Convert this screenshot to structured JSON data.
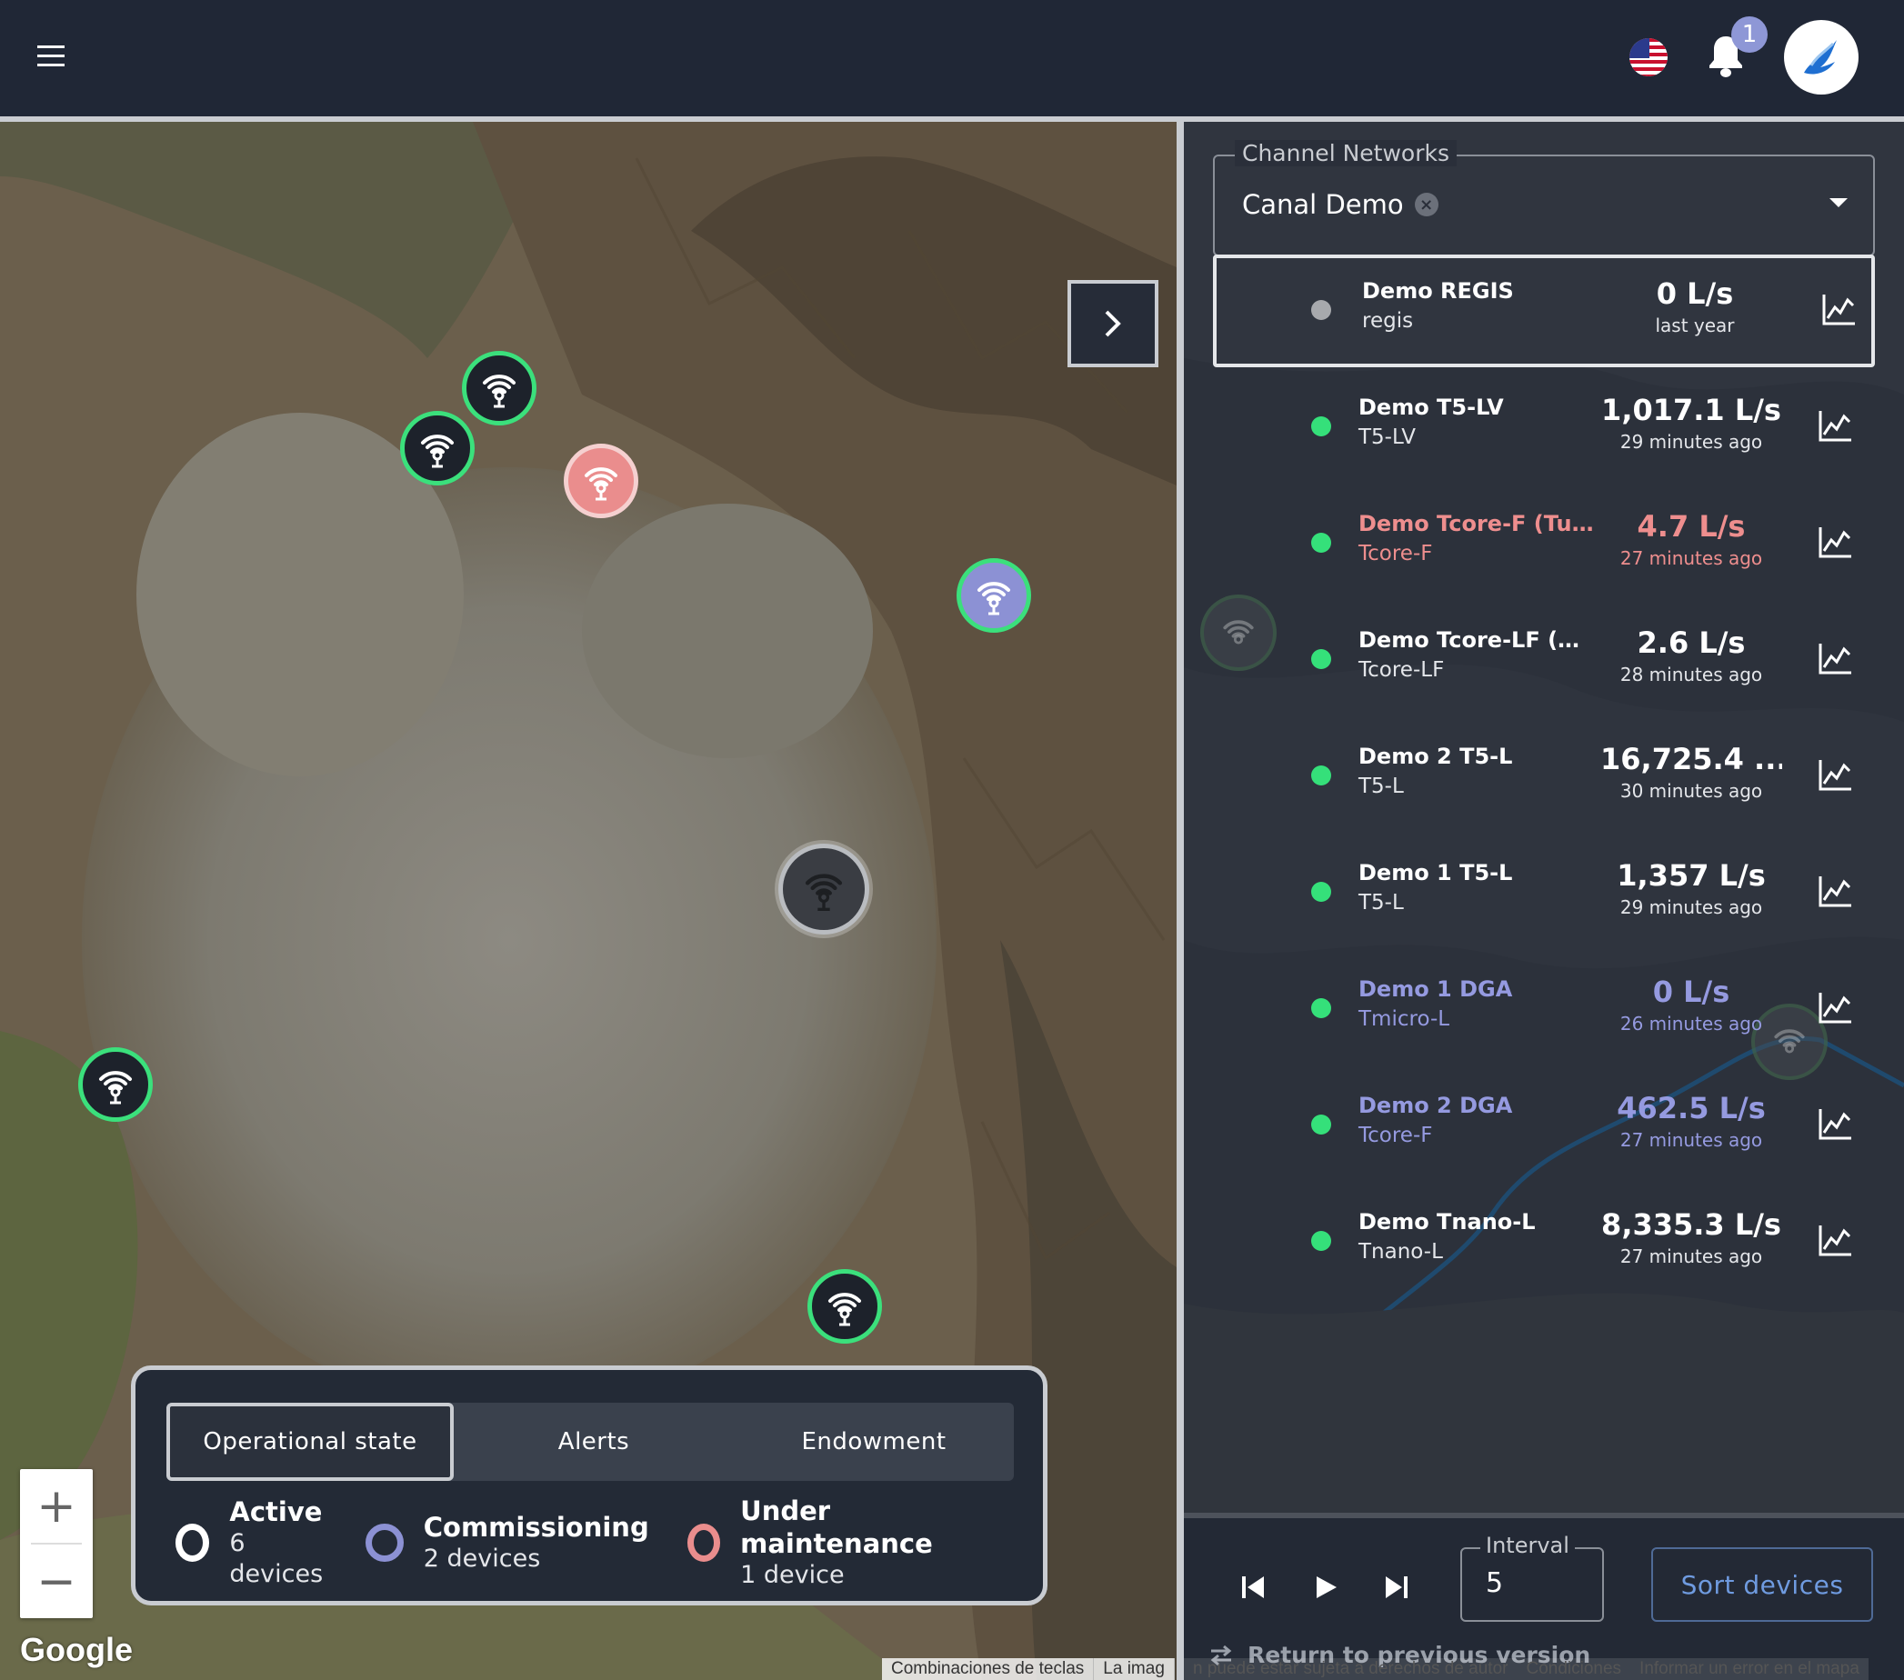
{
  "header": {
    "menu_icon": "hamburger-menu-icon",
    "language_flag": "us-flag-icon",
    "notifications_count": "1",
    "avatar_icon": "bird-logo-icon"
  },
  "map": {
    "google_logo": "Google",
    "attribution": [
      "Combinaciones de teclas",
      "La imag"
    ],
    "zoom_in": "+",
    "zoom_out": "−"
  },
  "legend": {
    "tabs": [
      "Operational state",
      "Alerts",
      "Endowment"
    ],
    "selected_tab": "Operational state",
    "items": [
      {
        "title": "Active",
        "sub": "6 devices",
        "color": "#ffffff"
      },
      {
        "title": "Commissioning",
        "sub": "2 devices",
        "color": "#8c91d4"
      },
      {
        "title": "Under maintenance",
        "sub": "1 device",
        "color": "#ea8d8d"
      }
    ]
  },
  "panel": {
    "channel_label": "Channel Networks",
    "channel_value": "Canal Demo",
    "devices": [
      {
        "name": "Demo REGIS",
        "code": "regis",
        "value": "0 L/s",
        "time": "last year",
        "status": "inactive"
      },
      {
        "name": "Demo T5-LV",
        "code": "T5-LV",
        "value": "1,017.1 L/s",
        "time": "29 minutes ago",
        "status": "active"
      },
      {
        "name": "Demo Tcore-F (Tub...",
        "code": "Tcore-F",
        "value": "4.7 L/s",
        "time": "27 minutes ago",
        "status": "maintenance"
      },
      {
        "name": "Demo Tcore-LF (Po...",
        "code": "Tcore-LF",
        "value": "2.6 L/s",
        "time": "28 minutes ago",
        "status": "active"
      },
      {
        "name": "Demo 2 T5-L",
        "code": "T5-L",
        "value": "16,725.4 ...",
        "time": "30 minutes ago",
        "status": "active"
      },
      {
        "name": "Demo 1 T5-L",
        "code": "T5-L",
        "value": "1,357 L/s",
        "time": "29 minutes ago",
        "status": "active"
      },
      {
        "name": "Demo 1 DGA",
        "code": "Tmicro-L",
        "value": "0 L/s",
        "time": "26 minutes ago",
        "status": "commissioning"
      },
      {
        "name": "Demo 2 DGA",
        "code": "Tcore-F",
        "value": "462.5 L/s",
        "time": "27 minutes ago",
        "status": "commissioning"
      },
      {
        "name": "Demo Tnano-L",
        "code": "Tnano-L",
        "value": "8,335.3 L/s",
        "time": "27 minutes ago",
        "status": "active"
      }
    ],
    "interval_label": "Interval",
    "interval_value": "5",
    "sort_button": "Sort devices",
    "return_link": "Return to previous version",
    "attribution": [
      "n puede estar sujeta a derechos de autor",
      "Condiciones",
      "Informar un error en el mapa"
    ]
  },
  "colors": {
    "active": "#35e07a",
    "commissioning": "#8c91d4",
    "maintenance": "#ea8d8d",
    "inactive": "#a7a9ad"
  }
}
